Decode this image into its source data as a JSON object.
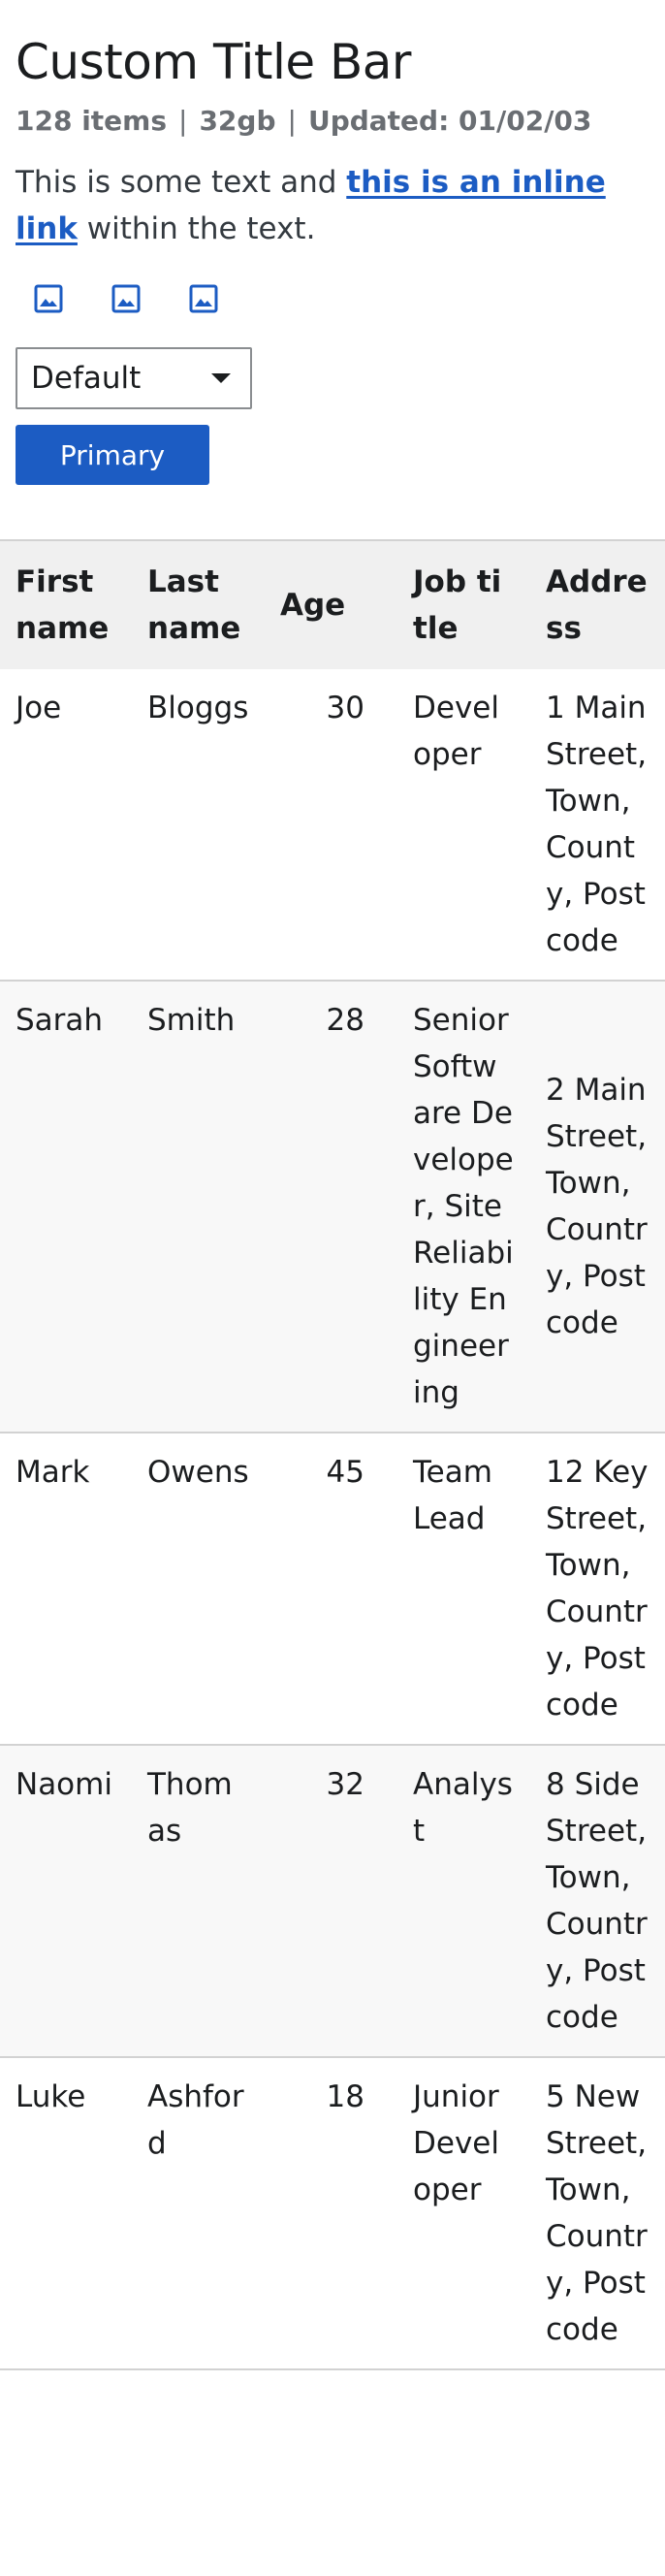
{
  "header": {
    "title": "Custom Title Bar",
    "meta": [
      "128 items",
      "32gb",
      "Updated: 01/02/03"
    ],
    "meta_separator": "|"
  },
  "paragraph": {
    "before": "This is some text and ",
    "link": "this is an inline link",
    "after": " within the text."
  },
  "icons": [
    "image-icon",
    "image-icon",
    "image-icon"
  ],
  "select": {
    "value": "Default"
  },
  "primary_button": {
    "label": "Primary"
  },
  "colors": {
    "accent": "#1c5cc3",
    "meta_text": "#6a6e73",
    "header_bg": "#f0f0f0",
    "stripe_bg": "#f8f8f8"
  },
  "table": {
    "headers": [
      "First name",
      "Last name",
      "Age",
      "Job title",
      "Address"
    ],
    "rows": [
      [
        "Joe",
        "Bloggs",
        "30",
        "Developer",
        "1 Main Street, Town, County, Postcode"
      ],
      [
        "Sarah",
        "Smith",
        "28",
        "Senior Software Developer, Site Reliability Engineering",
        "2 Main Street, Town, Country, Postcode"
      ],
      [
        "Mark",
        "Owens",
        "45",
        "Team Lead",
        "12 Key Street, Town, Country, Postcode"
      ],
      [
        "Naomi",
        "Thomas",
        "32",
        "Analyst",
        "8 Side Street, Town, Country, Postcode"
      ],
      [
        "Luke",
        "Ashford",
        "18",
        "Junior Developer",
        "5 New Street, Town, Country, Postcode"
      ]
    ]
  }
}
